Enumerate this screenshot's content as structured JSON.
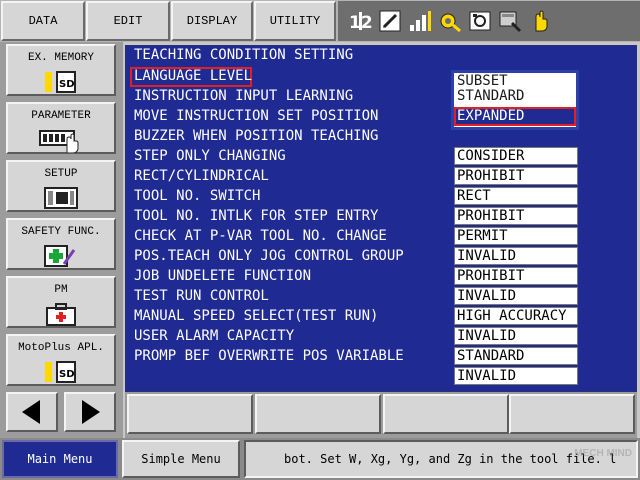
{
  "topbar": {
    "data_label": "DATA",
    "edit_label": "EDIT",
    "display_label": "DISPLAY",
    "utility_label": "UTILITY",
    "status_icons": [
      "program-level-icon",
      "edit-lock-icon",
      "signal-level-icon",
      "tool-icon",
      "storage-icon",
      "teach-mode-icon",
      "hand-icon"
    ]
  },
  "sidebar": {
    "items": [
      {
        "label": "EX. MEMORY",
        "icon": "sd-card-icon"
      },
      {
        "label": "PARAMETER",
        "icon": "parameter-icon"
      },
      {
        "label": "SETUP",
        "icon": "setup-icon"
      },
      {
        "label": "SAFETY FUNC.",
        "icon": "safety-icon"
      },
      {
        "label": "PM",
        "icon": "toolbox-icon"
      },
      {
        "label": "MotoPlus APL.",
        "icon": "sd-card-icon"
      }
    ],
    "left_arrow": "left-arrow-icon",
    "right_arrow": "right-arrow-icon"
  },
  "main": {
    "title": "TEACHING CONDITION SETTING",
    "rows": [
      {
        "label": "LANGUAGE LEVEL",
        "value": ""
      },
      {
        "label": "INSTRUCTION INPUT LEARNING",
        "value": ""
      },
      {
        "label": "MOVE INSTRUCTION SET POSITION",
        "value": ""
      },
      {
        "label": "BUZZER WHEN POSITION TEACHING",
        "value": "CONSIDER"
      },
      {
        "label": "STEP ONLY CHANGING",
        "value": "PROHIBIT"
      },
      {
        "label": "RECT/CYLINDRICAL",
        "value": "RECT"
      },
      {
        "label": "TOOL NO. SWITCH",
        "value": "PROHIBIT"
      },
      {
        "label": "TOOL NO. INTLK FOR STEP ENTRY",
        "value": "PERMIT"
      },
      {
        "label": "CHECK AT P-VAR TOOL NO. CHANGE",
        "value": "INVALID"
      },
      {
        "label": "POS.TEACH ONLY JOG CONTROL GROUP",
        "value": "PROHIBIT"
      },
      {
        "label": "JOB UNDELETE FUNCTION",
        "value": "INVALID"
      },
      {
        "label": "TEST RUN CONTROL",
        "value": "HIGH ACCURACY"
      },
      {
        "label": "MANUAL SPEED SELECT(TEST RUN)",
        "value": "INVALID"
      },
      {
        "label": "USER ALARM CAPACITY",
        "value": "STANDARD"
      },
      {
        "label": "PROMP BEF OVERWRITE POS VARIABLE",
        "value": "INVALID"
      }
    ],
    "dropdown": {
      "options": [
        "SUBSET",
        "STANDARD",
        "EXPANDED"
      ],
      "selected": "EXPANDED"
    }
  },
  "bottombar": {
    "main_menu_label": "Main Menu",
    "simple_menu_label": "Simple Menu",
    "message": "bot. Set W, Xg, Yg, and Zg in the tool file.  l"
  },
  "watermark": "MECH MIND",
  "colors": {
    "accent_blue": "#1f2a93",
    "highlight_red": "#e41f1f"
  }
}
